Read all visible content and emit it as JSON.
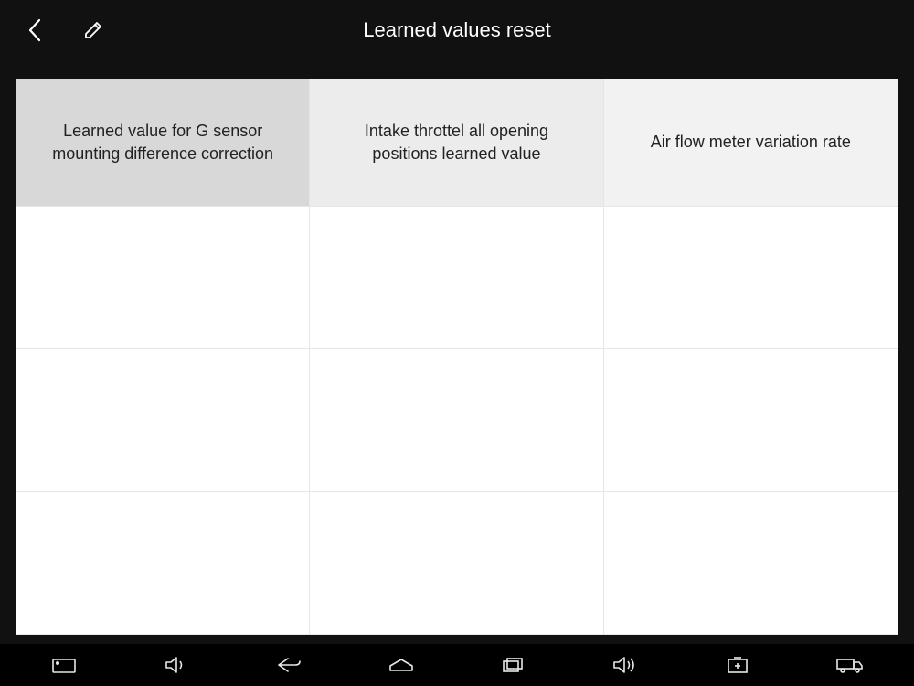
{
  "header": {
    "title": "Learned values reset"
  },
  "grid": {
    "options": [
      "Learned value for G sensor mounting difference correction",
      "Intake throttel all opening positions learned value",
      "Air flow meter variation rate"
    ]
  }
}
